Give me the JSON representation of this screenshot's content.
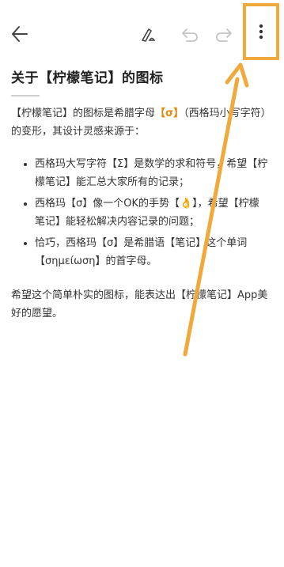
{
  "toolbar": {
    "back_icon": "arrow-left-icon",
    "format_icon": "pen-format-icon",
    "undo_icon": "undo-icon",
    "redo_icon": "redo-icon",
    "more_icon": "more-vertical-icon"
  },
  "note": {
    "title": "关于【柠檬笔记】的图标",
    "intro_before": "【柠檬笔记】的图标是希腊字母",
    "intro_highlight": "【σ】",
    "intro_after": "（西格玛小写字符）的变形，其设计灵感来源于：",
    "bullets": [
      "西格玛大写字符【Σ】是数学的求和符号，希望【柠檬笔记】能汇总大家所有的记录；",
      "西格玛【σ】像一个OK的手势【👌】，希望【柠檬笔记】能轻松解决内容记录的问题；",
      "恰巧，西格玛【σ】是希腊语【笔记】这个单词【σημείωση】的首字母。"
    ],
    "outro": "希望这个简单朴实的图标，能表达出【柠檬笔记】App美好的愿望。"
  },
  "colors": {
    "highlight": "#f0a93b",
    "arrow": "#f0a93b",
    "text": "#333333"
  }
}
